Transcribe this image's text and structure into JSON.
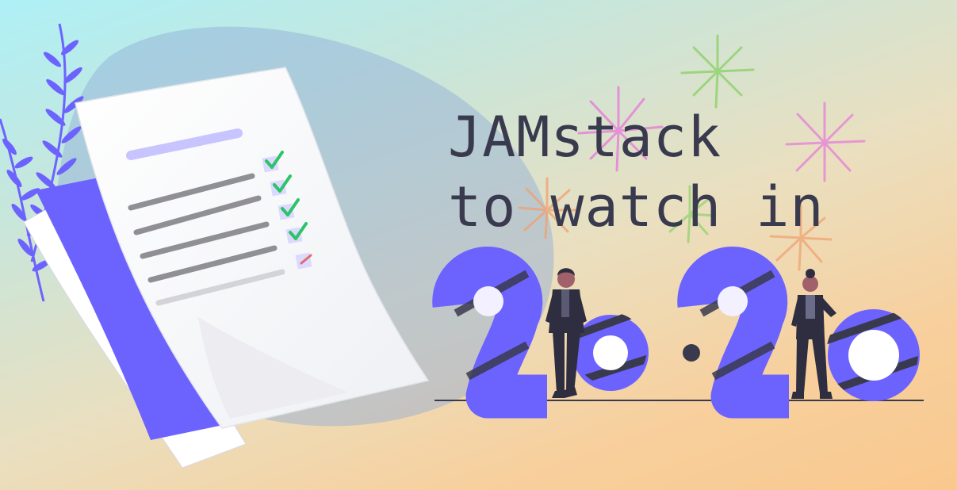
{
  "headline": {
    "line1": "JAMstack",
    "line2": "to watch in",
    "year": "2020"
  },
  "colors": {
    "accent_purple": "#6c63ff",
    "ink": "#3a3a4e",
    "checkmark_green": "#2ec36a",
    "paper": "#ffffff"
  },
  "icons": [
    "checkmark-icon",
    "pencil-icon",
    "fern-leaf-icon",
    "firework-icon"
  ],
  "checklist": {
    "checked_items": 4,
    "total_items": 5
  }
}
